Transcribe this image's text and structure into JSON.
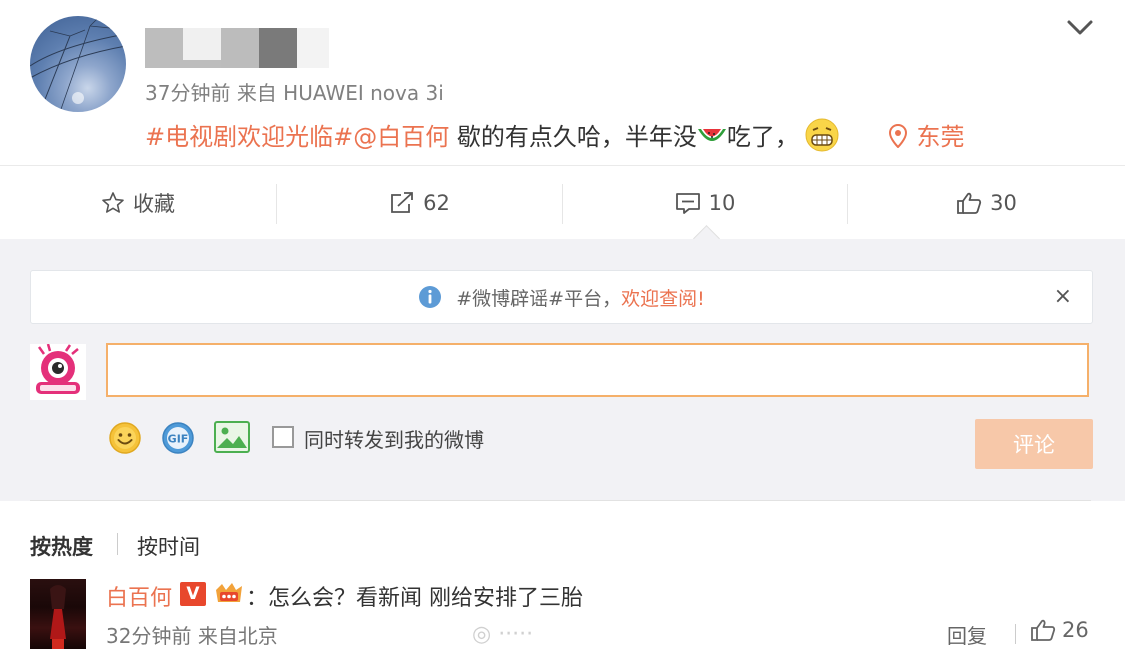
{
  "post": {
    "time": "37分钟前",
    "from_label": "来自",
    "device": "HUAWEI nova 3i",
    "hashtag": "#电视剧欢迎光临#",
    "mention": "@白百何",
    "text_before_emoji": "歇的有点久哈，半年没",
    "text_after_emoji": "吃了，",
    "location": "东莞",
    "emoji_1": "watermelon-emoji",
    "emoji_2": "grin-emoji"
  },
  "actions": {
    "favorite_label": "收藏",
    "repost_count": "62",
    "comment_count": "10",
    "like_count": "30"
  },
  "notice": {
    "text": "#微博辟谣#平台，",
    "highlight": "欢迎查阅!",
    "close": "×"
  },
  "composer": {
    "input_value": "",
    "repost_label": "同时转发到我的微博",
    "submit_label": "评论"
  },
  "sort": {
    "hot": "按热度",
    "time": "按时间"
  },
  "comments": [
    {
      "author": "白百何",
      "verified_badge": "V",
      "text": "：怎么会？看新闻 刚给安排了三胎",
      "time": "32分钟前",
      "from": "来自北京",
      "reply_label": "回复",
      "likes": "26"
    }
  ],
  "colors": {
    "accent": "#eb7350",
    "submit_disabled": "#f7c8a9",
    "panel_bg": "#f2f2f5"
  }
}
